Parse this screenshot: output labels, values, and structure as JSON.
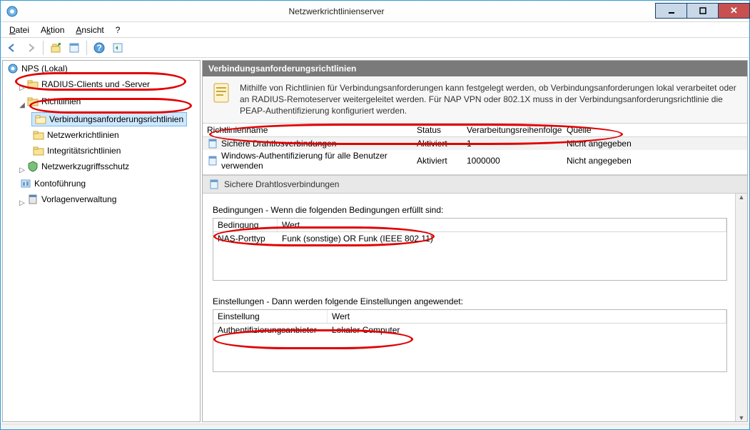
{
  "window": {
    "title": "Netzwerkrichtlinienserver"
  },
  "menu": {
    "file": "Datei",
    "action": "Aktion",
    "view": "Ansicht",
    "help": "?"
  },
  "tree": {
    "root": "NPS (Lokal)",
    "radius": "RADIUS-Clients und -Server",
    "policies": "Richtlinien",
    "crp": "Verbindungsanforderungsrichtlinien",
    "netpol": "Netzwerkrichtlinien",
    "healthpol": "Integritätsrichtlinien",
    "nap": "Netzwerkzugriffsschutz",
    "accounting": "Kontoführung",
    "templates": "Vorlagenverwaltung"
  },
  "panel": {
    "title": "Verbindungsanforderungsrichtlinien",
    "info": "Mithilfe von Richtlinien für Verbindungsanforderungen kann festgelegt werden, ob Verbindungsanforderungen lokal verarbeitet oder an RADIUS-Remoteserver weitergeleitet werden. Für NAP VPN oder 802.1X muss in der Verbindungsanforderungsrichtlinie die PEAP-Authentifizierung konfiguriert werden."
  },
  "columns": {
    "name": "Richtlinienname",
    "status": "Status",
    "order": "Verarbeitungsreihenfolge",
    "source": "Quelle"
  },
  "rows": [
    {
      "name": "Sichere Drahtlosverbindungen",
      "status": "Aktiviert",
      "order": "1",
      "source": "Nicht angegeben"
    },
    {
      "name": "Windows-Authentifizierung für alle Benutzer verwenden",
      "status": "Aktiviert",
      "order": "1000000",
      "source": "Nicht angegeben"
    }
  ],
  "detail": {
    "title": "Sichere Drahtlosverbindungen",
    "cond_label": "Bedingungen - Wenn die folgenden Bedingungen erfüllt sind:",
    "cond_cols": {
      "c1": "Bedingung",
      "c2": "Wert"
    },
    "cond_rows": [
      {
        "c1": "NAS-Porttyp",
        "c2": "Funk (sonstige) OR Funk (IEEE 802.11)"
      }
    ],
    "set_label": "Einstellungen - Dann werden folgende Einstellungen angewendet:",
    "set_cols": {
      "c1": "Einstellung",
      "c2": "Wert"
    },
    "set_rows": [
      {
        "c1": "Authentifizierungsanbieter",
        "c2": "Lokaler Computer"
      }
    ]
  }
}
